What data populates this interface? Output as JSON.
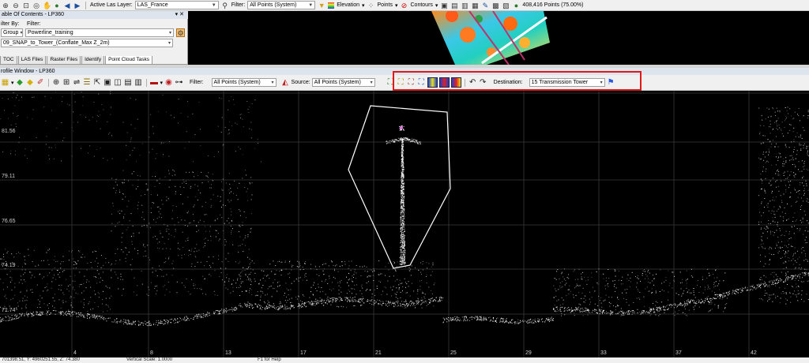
{
  "top_toolbar": {
    "active_layer_label": "Active Las Layer:",
    "active_layer_value": "LAS_France",
    "filter_label": "Filter:",
    "filter_value": "All Points (System)",
    "elevation_label": "Elevation",
    "points_label": "Points",
    "contours_label": "Contours",
    "points_count": "408,416 Points (75.00%)"
  },
  "toc": {
    "title": "able Of Contents - LP360",
    "filter_by_label": "ilter By:",
    "filter_label": "Filter:",
    "filter_by_value": "Group",
    "filter_value": "Powerline_training",
    "task_value": "09_SNAP_to_Tower_(Conflate_Max Z_2m)",
    "tabs": [
      "TOC",
      "LAS Files",
      "Raster Files",
      "Identify",
      "Point Cloud Tasks"
    ]
  },
  "profile": {
    "window_title": "rofile Window - LP360",
    "filter_label": "Filter:",
    "filter_value": "All Points (System)",
    "source_label": "Source:",
    "source_value": "All Points (System)",
    "destination_label": "Destination:",
    "destination_value": "15  Transmission Tower",
    "y_labels": [
      "81.56",
      "79.11",
      "76.65",
      "74.19",
      "71.74"
    ],
    "x_labels": [
      "4",
      "8",
      "13",
      "17",
      "21",
      "25",
      "29",
      "33",
      "37",
      "42"
    ]
  },
  "status": {
    "coords": "701398.51,  Y: 4960251.55,  Z: 74.380",
    "vertical_scale": "Vertical Scale: 1.0000",
    "help": "F1 for Help"
  },
  "colors": {
    "highlight": "#e01818",
    "canvas_bg": "#000000",
    "toolbar_bg": "#f0f0f0",
    "title_bar_bg": "#dde4ee"
  }
}
